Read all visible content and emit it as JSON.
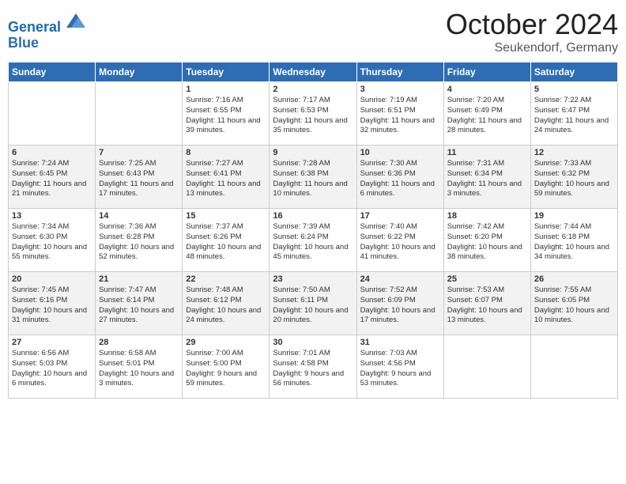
{
  "header": {
    "logo_line1": "General",
    "logo_line2": "Blue",
    "month": "October 2024",
    "location": "Seukendorf, Germany"
  },
  "weekdays": [
    "Sunday",
    "Monday",
    "Tuesday",
    "Wednesday",
    "Thursday",
    "Friday",
    "Saturday"
  ],
  "weeks": [
    [
      {
        "day": "",
        "text": ""
      },
      {
        "day": "",
        "text": ""
      },
      {
        "day": "1",
        "text": "Sunrise: 7:16 AM\nSunset: 6:55 PM\nDaylight: 11 hours and 39 minutes."
      },
      {
        "day": "2",
        "text": "Sunrise: 7:17 AM\nSunset: 6:53 PM\nDaylight: 11 hours and 35 minutes."
      },
      {
        "day": "3",
        "text": "Sunrise: 7:19 AM\nSunset: 6:51 PM\nDaylight: 11 hours and 32 minutes."
      },
      {
        "day": "4",
        "text": "Sunrise: 7:20 AM\nSunset: 6:49 PM\nDaylight: 11 hours and 28 minutes."
      },
      {
        "day": "5",
        "text": "Sunrise: 7:22 AM\nSunset: 6:47 PM\nDaylight: 11 hours and 24 minutes."
      }
    ],
    [
      {
        "day": "6",
        "text": "Sunrise: 7:24 AM\nSunset: 6:45 PM\nDaylight: 11 hours and 21 minutes."
      },
      {
        "day": "7",
        "text": "Sunrise: 7:25 AM\nSunset: 6:43 PM\nDaylight: 11 hours and 17 minutes."
      },
      {
        "day": "8",
        "text": "Sunrise: 7:27 AM\nSunset: 6:41 PM\nDaylight: 11 hours and 13 minutes."
      },
      {
        "day": "9",
        "text": "Sunrise: 7:28 AM\nSunset: 6:38 PM\nDaylight: 11 hours and 10 minutes."
      },
      {
        "day": "10",
        "text": "Sunrise: 7:30 AM\nSunset: 6:36 PM\nDaylight: 11 hours and 6 minutes."
      },
      {
        "day": "11",
        "text": "Sunrise: 7:31 AM\nSunset: 6:34 PM\nDaylight: 11 hours and 3 minutes."
      },
      {
        "day": "12",
        "text": "Sunrise: 7:33 AM\nSunset: 6:32 PM\nDaylight: 10 hours and 59 minutes."
      }
    ],
    [
      {
        "day": "13",
        "text": "Sunrise: 7:34 AM\nSunset: 6:30 PM\nDaylight: 10 hours and 55 minutes."
      },
      {
        "day": "14",
        "text": "Sunrise: 7:36 AM\nSunset: 6:28 PM\nDaylight: 10 hours and 52 minutes."
      },
      {
        "day": "15",
        "text": "Sunrise: 7:37 AM\nSunset: 6:26 PM\nDaylight: 10 hours and 48 minutes."
      },
      {
        "day": "16",
        "text": "Sunrise: 7:39 AM\nSunset: 6:24 PM\nDaylight: 10 hours and 45 minutes."
      },
      {
        "day": "17",
        "text": "Sunrise: 7:40 AM\nSunset: 6:22 PM\nDaylight: 10 hours and 41 minutes."
      },
      {
        "day": "18",
        "text": "Sunrise: 7:42 AM\nSunset: 6:20 PM\nDaylight: 10 hours and 38 minutes."
      },
      {
        "day": "19",
        "text": "Sunrise: 7:44 AM\nSunset: 6:18 PM\nDaylight: 10 hours and 34 minutes."
      }
    ],
    [
      {
        "day": "20",
        "text": "Sunrise: 7:45 AM\nSunset: 6:16 PM\nDaylight: 10 hours and 31 minutes."
      },
      {
        "day": "21",
        "text": "Sunrise: 7:47 AM\nSunset: 6:14 PM\nDaylight: 10 hours and 27 minutes."
      },
      {
        "day": "22",
        "text": "Sunrise: 7:48 AM\nSunset: 6:12 PM\nDaylight: 10 hours and 24 minutes."
      },
      {
        "day": "23",
        "text": "Sunrise: 7:50 AM\nSunset: 6:11 PM\nDaylight: 10 hours and 20 minutes."
      },
      {
        "day": "24",
        "text": "Sunrise: 7:52 AM\nSunset: 6:09 PM\nDaylight: 10 hours and 17 minutes."
      },
      {
        "day": "25",
        "text": "Sunrise: 7:53 AM\nSunset: 6:07 PM\nDaylight: 10 hours and 13 minutes."
      },
      {
        "day": "26",
        "text": "Sunrise: 7:55 AM\nSunset: 6:05 PM\nDaylight: 10 hours and 10 minutes."
      }
    ],
    [
      {
        "day": "27",
        "text": "Sunrise: 6:56 AM\nSunset: 5:03 PM\nDaylight: 10 hours and 6 minutes."
      },
      {
        "day": "28",
        "text": "Sunrise: 6:58 AM\nSunset: 5:01 PM\nDaylight: 10 hours and 3 minutes."
      },
      {
        "day": "29",
        "text": "Sunrise: 7:00 AM\nSunset: 5:00 PM\nDaylight: 9 hours and 59 minutes."
      },
      {
        "day": "30",
        "text": "Sunrise: 7:01 AM\nSunset: 4:58 PM\nDaylight: 9 hours and 56 minutes."
      },
      {
        "day": "31",
        "text": "Sunrise: 7:03 AM\nSunset: 4:56 PM\nDaylight: 9 hours and 53 minutes."
      },
      {
        "day": "",
        "text": ""
      },
      {
        "day": "",
        "text": ""
      }
    ]
  ]
}
